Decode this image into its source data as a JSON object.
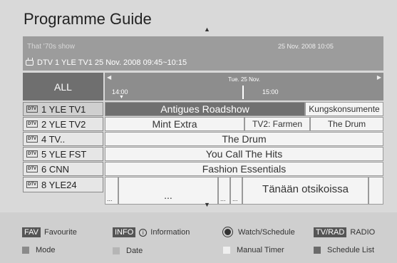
{
  "header": {
    "title": "Programme Guide",
    "scroll_up": "▲",
    "scroll_down": "▼"
  },
  "info": {
    "show_title": "That '70s show",
    "now": "25 Nov. 2008 10:05",
    "channel_line": "DTV 1 YLE TV1 25 Nov. 2008 09:45~10:15"
  },
  "grid": {
    "all_label": "ALL",
    "date": "Tue. 25 Nov.",
    "times": [
      "14:00",
      "15:00"
    ],
    "channels": [
      {
        "badge": "DTV",
        "label": "1  YLE TV1"
      },
      {
        "badge": "DTV",
        "label": "2  YLE TV2"
      },
      {
        "badge": "DTV",
        "label": "4  TV.."
      },
      {
        "badge": "DTV",
        "label": "5  YLE FST"
      },
      {
        "badge": "DTV",
        "label": "6  CNN"
      },
      {
        "badge": "DTV",
        "label": "8  YLE24"
      }
    ],
    "rows": [
      [
        "Antigues Roadshow",
        "Kungskonsumente"
      ],
      [
        "Mint Extra",
        "TV2: Farmen",
        "The Drum"
      ],
      [
        "The Drum"
      ],
      [
        "You Call The Hits"
      ],
      [
        "Fashion Essentials"
      ],
      [
        "...",
        "...",
        "...",
        "...",
        "Tänään otsikoissa",
        ""
      ]
    ]
  },
  "legend": {
    "fav_badge": "FAV",
    "fav_label": "Favourite",
    "info_badge": "INFO",
    "info_label": "Information",
    "watch_label": "Watch/Schedule",
    "tvrad_badge": "TV/RAD",
    "radio_label": "RADIO",
    "mode_label": "Mode",
    "date_label": "Date",
    "manual_label": "Manual Timer",
    "schedule_label": "Schedule List"
  },
  "colors": {
    "red_key": "#8a8a8a",
    "green_key": "#b5b5b5",
    "yellow_key": "#efefef",
    "blue_key": "#6b6b6b"
  }
}
